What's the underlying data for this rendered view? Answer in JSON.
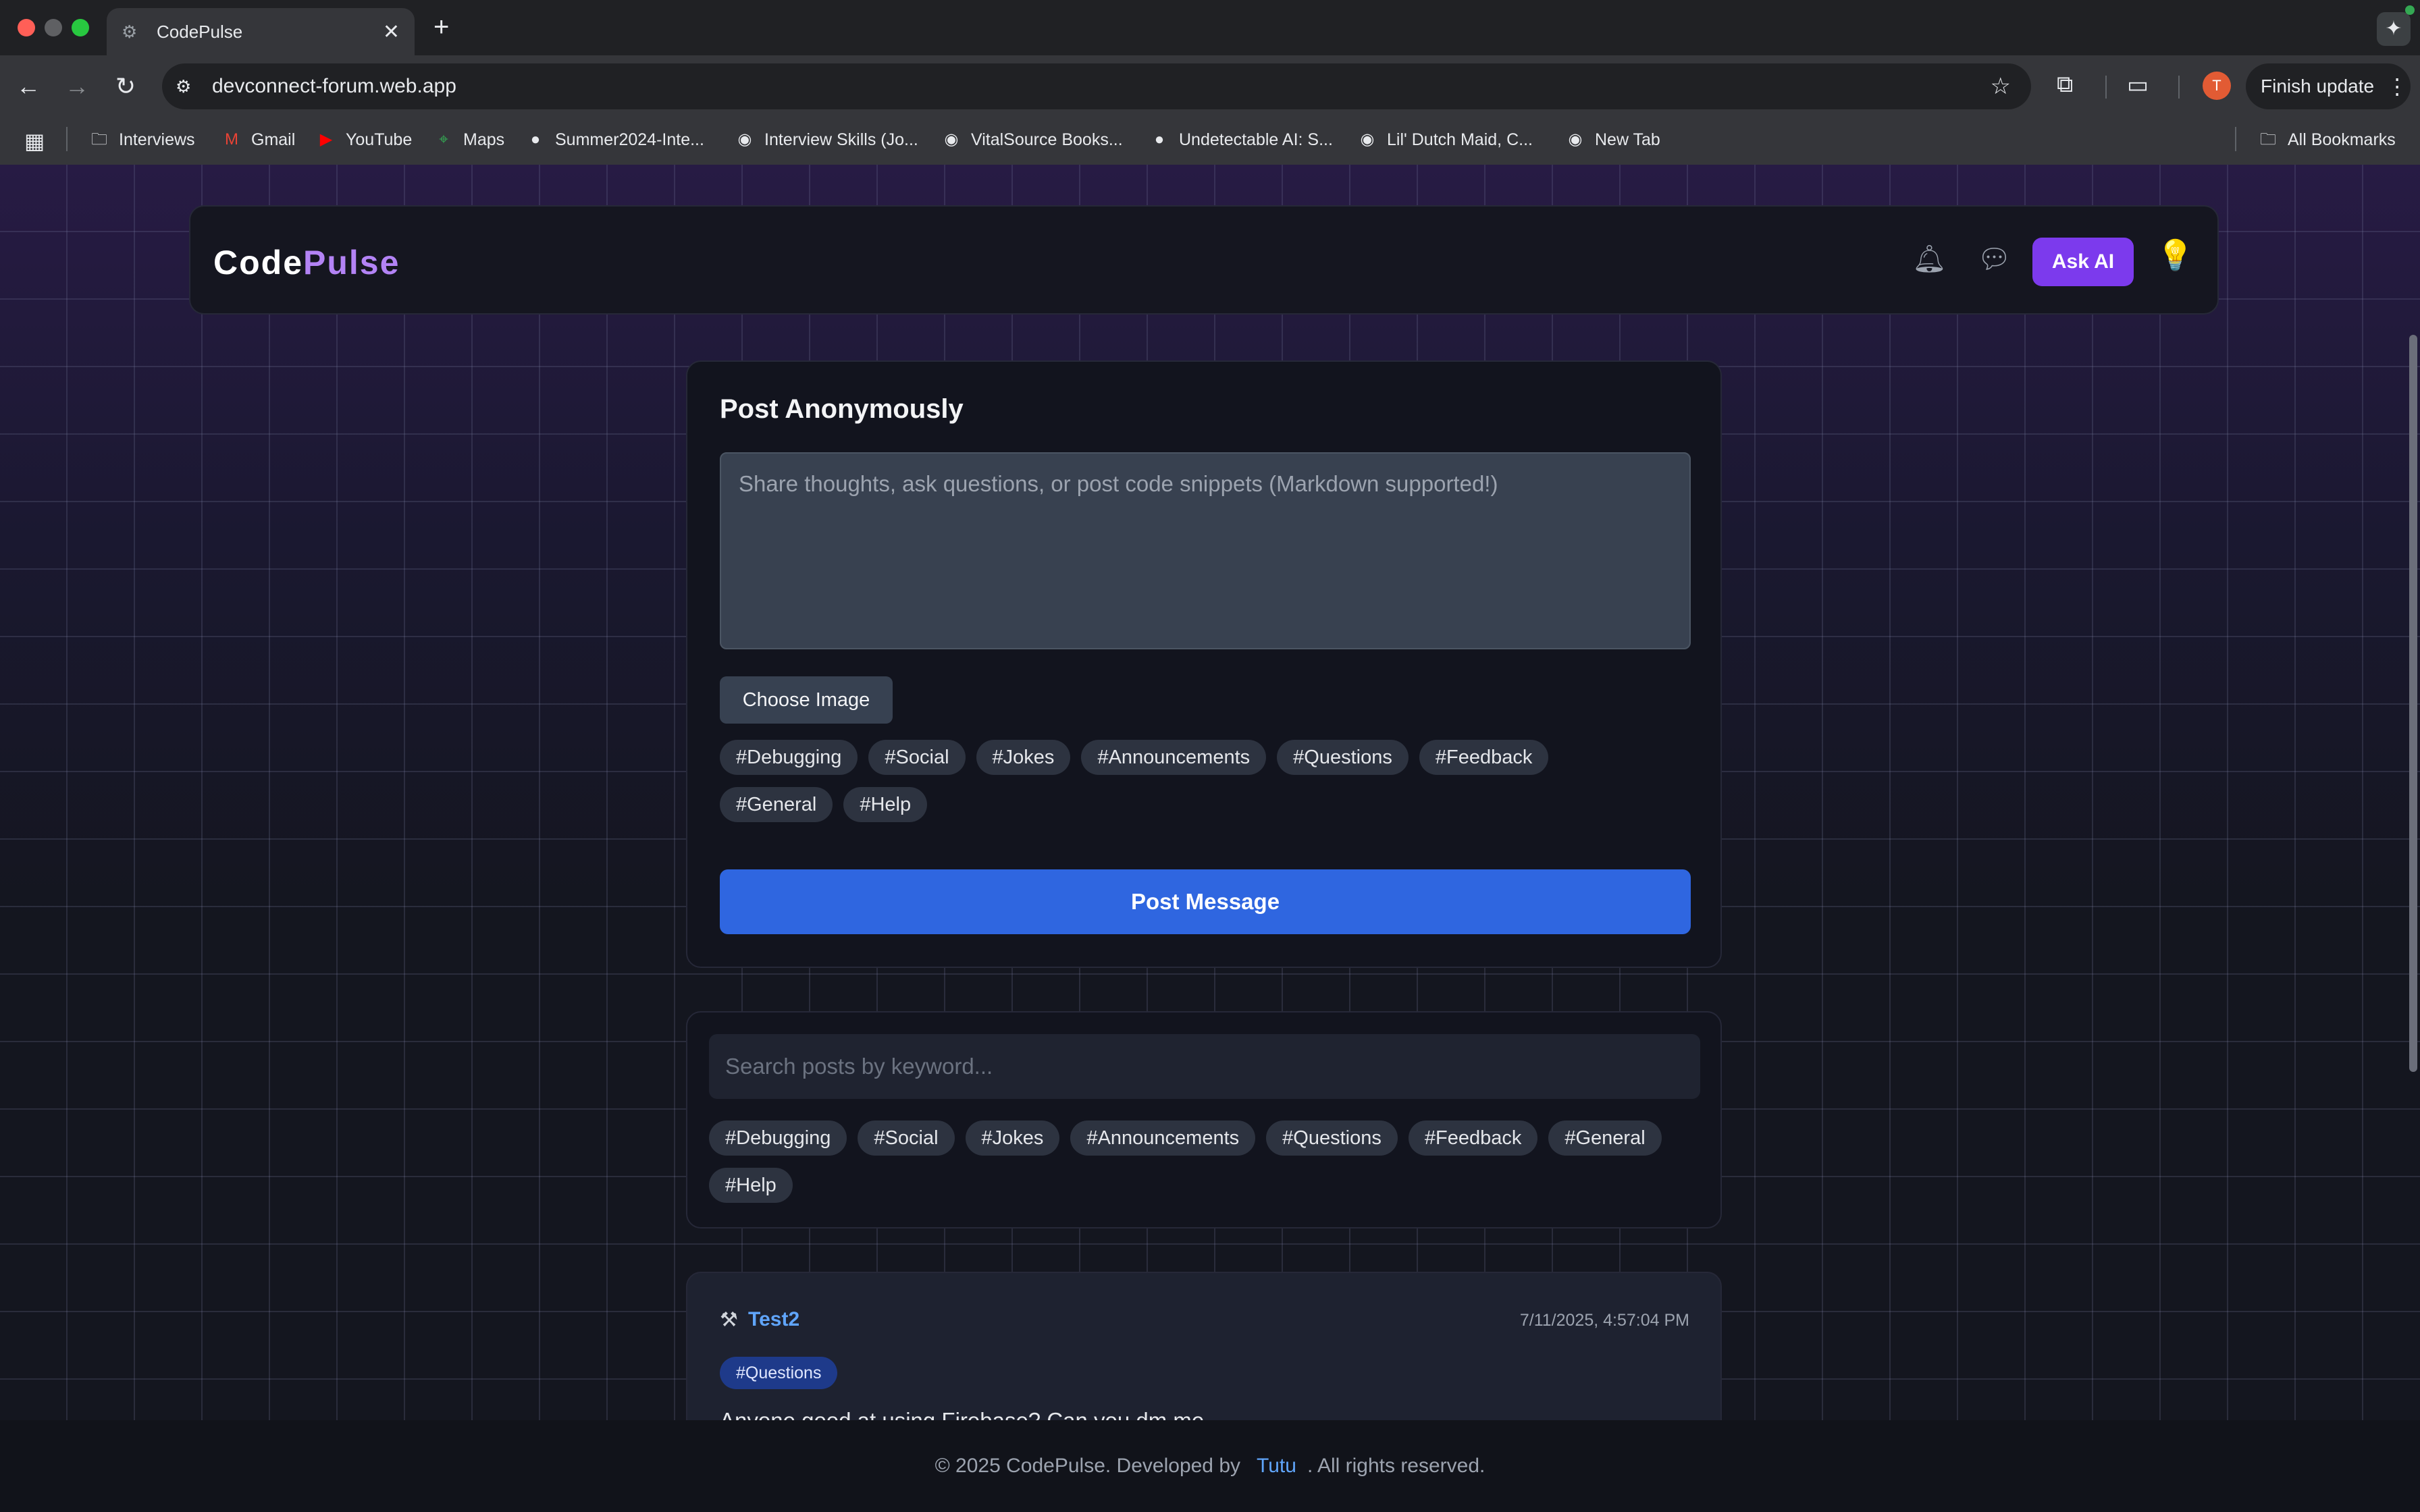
{
  "browser": {
    "tab_title": "CodePulse",
    "url": "devconnect-forum.web.app",
    "finish_update": "Finish update",
    "profile_initial": "T",
    "bookmarks": [
      {
        "label": "Interviews",
        "icon": "folder-icon"
      },
      {
        "label": "Gmail",
        "icon": "gmail-icon"
      },
      {
        "label": "YouTube",
        "icon": "youtube-icon"
      },
      {
        "label": "Maps",
        "icon": "maps-icon"
      },
      {
        "label": "Summer2024-Inte...",
        "icon": "github-icon"
      },
      {
        "label": "Interview Skills (Jo...",
        "icon": "globe-icon"
      },
      {
        "label": "VitalSource Books...",
        "icon": "globe-icon"
      },
      {
        "label": "Undetectable AI: S...",
        "icon": "undetectable-icon"
      },
      {
        "label": "Lil' Dutch Maid, C...",
        "icon": "globe-icon"
      },
      {
        "label": "New Tab",
        "icon": "globe-icon"
      }
    ],
    "all_bookmarks": "All Bookmarks"
  },
  "header": {
    "logo_part1": "Code",
    "logo_part2": "Pulse",
    "ask_ai": "Ask AI"
  },
  "composer": {
    "title": "Post Anonymously",
    "placeholder": "Share thoughts, ask questions, or post code snippets (Markdown supported!)",
    "choose_image": "Choose Image",
    "tags": [
      "#Debugging",
      "#Social",
      "#Jokes",
      "#Announcements",
      "#Questions",
      "#Feedback",
      "#General",
      "#Help"
    ],
    "post_button": "Post Message"
  },
  "search": {
    "placeholder": "Search posts by keyword...",
    "tags": [
      "#Debugging",
      "#Social",
      "#Jokes",
      "#Announcements",
      "#Questions",
      "#Feedback",
      "#General",
      "#Help"
    ]
  },
  "feed": {
    "posts": [
      {
        "user": "Test2",
        "timestamp": "7/11/2025, 4:57:04 PM",
        "tag": "#Questions",
        "body": "Anyone good at using Firebase? Can you dm me"
      }
    ]
  },
  "footer": {
    "prefix": "© 2025 CodePulse. Developed by",
    "developer": "Tutu",
    "suffix": ". All rights reserved."
  },
  "colors": {
    "accent_purple": "#7c3aed",
    "logo_accent": "#b383f5",
    "primary_blue": "#2f66e0",
    "link_blue": "#60a5fa"
  }
}
